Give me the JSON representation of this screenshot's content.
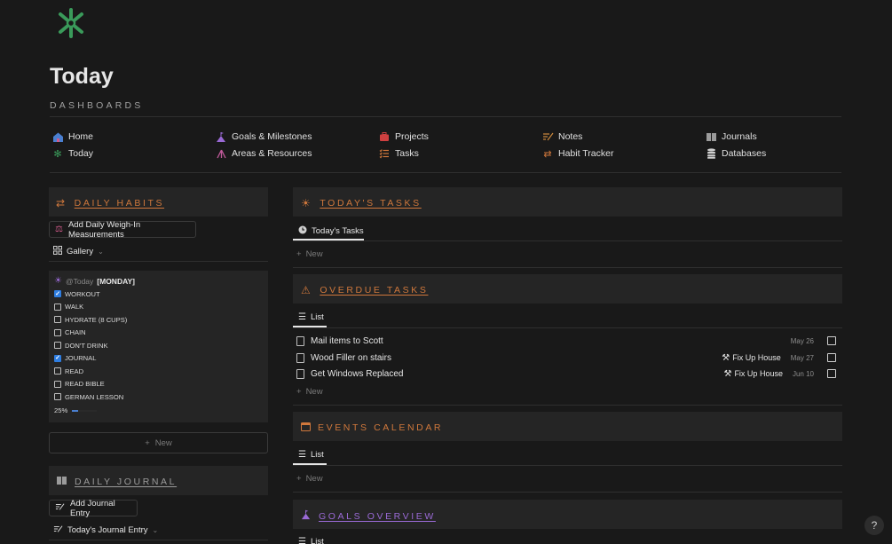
{
  "page": {
    "title": "Today",
    "subtitle": "DASHBOARDS"
  },
  "nav": {
    "col1": [
      {
        "label": "Home",
        "icon": "home-icon"
      },
      {
        "label": "Today",
        "icon": "sparkle-icon"
      }
    ],
    "col2": [
      {
        "label": "Goals & Milestones",
        "icon": "mountain-flag-icon"
      },
      {
        "label": "Areas & Resources",
        "icon": "network-icon"
      }
    ],
    "col3": [
      {
        "label": "Projects",
        "icon": "briefcase-icon"
      },
      {
        "label": "Tasks",
        "icon": "checklist-icon"
      }
    ],
    "col4": [
      {
        "label": "Notes",
        "icon": "note-pen-icon"
      },
      {
        "label": "Habit Tracker",
        "icon": "repeat-icon"
      }
    ],
    "col5": [
      {
        "label": "Journals",
        "icon": "book-icon"
      },
      {
        "label": "Databases",
        "icon": "database-icon"
      }
    ]
  },
  "daily_habits": {
    "heading": "DAILY HABITS",
    "add_button": "Add Daily Weigh-In Measurements",
    "view": "Gallery",
    "card": {
      "date_mention": "@Today",
      "weekday": "[MONDAY]",
      "habits": [
        {
          "label": "WORKOUT",
          "checked": true
        },
        {
          "label": "WALK",
          "checked": false
        },
        {
          "label": "HYDRATE (8 CUPS)",
          "checked": false
        },
        {
          "label": "CHAIN",
          "checked": false
        },
        {
          "label": "DON'T DRINK",
          "checked": false
        },
        {
          "label": "JOURNAL",
          "checked": true
        },
        {
          "label": "READ",
          "checked": false
        },
        {
          "label": "READ BIBLE",
          "checked": false
        },
        {
          "label": "GERMAN LESSON",
          "checked": false
        }
      ],
      "progress_label": "25%",
      "progress": 0.25
    },
    "new_label": "New"
  },
  "daily_journal": {
    "heading": "DAILY JOURNAL",
    "add_button": "Add Journal Entry",
    "view": "Today's Journal Entry"
  },
  "todays_tasks": {
    "heading": "TODAY'S TASKS",
    "view": "Today's Tasks",
    "new_label": "New"
  },
  "overdue_tasks": {
    "heading": "OVERDUE TASKS",
    "view": "List",
    "rows": [
      {
        "title": "Mail items to Scott",
        "project": "",
        "date": "May 26"
      },
      {
        "title": "Wood Filler on stairs",
        "project": "Fix Up House",
        "date": "May 27"
      },
      {
        "title": "Get Windows Replaced",
        "project": "Fix Up House",
        "date": "Jun 10"
      }
    ],
    "new_label": "New"
  },
  "events_calendar": {
    "heading": "EVENTS CALENDAR",
    "view": "List",
    "new_label": "New"
  },
  "goals_overview": {
    "heading": "GOALS OVERVIEW",
    "view": "List"
  },
  "help": "?",
  "colors": {
    "background": "#191919",
    "panel": "#252525",
    "orange_heading": "#d0783c",
    "purple_heading": "#9a6ad6",
    "gray_heading": "#9b9b9b",
    "logo_green": "#3a9a5a",
    "checkbox_blue": "#2e7de0"
  }
}
